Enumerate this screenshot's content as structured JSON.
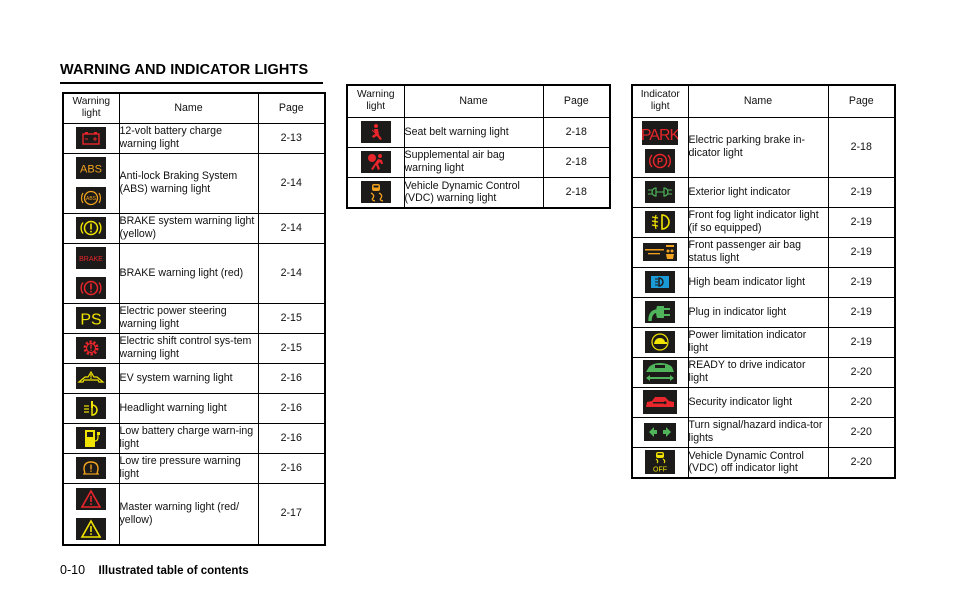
{
  "page_title": "WARNING AND INDICATOR LIGHTS",
  "tables": [
    {
      "headers": [
        "Warning light",
        "Name",
        "Page"
      ],
      "rows": [
        {
          "icons": [
            "battery-icon"
          ],
          "name": "12-volt battery charge warning light",
          "page": "2-13"
        },
        {
          "icons": [
            "abs-text-icon",
            "abs-circle-icon"
          ],
          "name": "Anti-lock Braking System (ABS) warning light",
          "page": "2-14"
        },
        {
          "icons": [
            "brake-yellow-icon"
          ],
          "name": "BRAKE system warning light (yellow)",
          "page": "2-14"
        },
        {
          "icons": [
            "brake-text-red-icon",
            "brake-circle-red-icon"
          ],
          "name": "BRAKE warning light (red)",
          "page": "2-14"
        },
        {
          "icons": [
            "ps-icon"
          ],
          "name": "Electric power steering warning light",
          "page": "2-15"
        },
        {
          "icons": [
            "shift-gear-icon"
          ],
          "name": "Electric shift control sys-tem warning light",
          "page": "2-15"
        },
        {
          "icons": [
            "ev-system-icon"
          ],
          "name": "EV system warning light",
          "page": "2-16"
        },
        {
          "icons": [
            "headlight-icon"
          ],
          "name": "Headlight warning light",
          "page": "2-16"
        },
        {
          "icons": [
            "low-battery-charge-icon"
          ],
          "name": "Low battery charge warn-ing light",
          "page": "2-16"
        },
        {
          "icons": [
            "tire-pressure-icon"
          ],
          "name": "Low tire pressure warning light",
          "page": "2-16"
        },
        {
          "icons": [
            "master-warning-red-icon",
            "master-warning-yellow-icon"
          ],
          "name": "Master warning light (red/ yellow)",
          "page": "2-17"
        }
      ]
    },
    {
      "headers": [
        "Warning light",
        "Name",
        "Page"
      ],
      "rows": [
        {
          "icons": [
            "seat-belt-icon"
          ],
          "name": "Seat belt warning light",
          "page": "2-18"
        },
        {
          "icons": [
            "airbag-icon"
          ],
          "name": "Supplemental air bag warning light",
          "page": "2-18"
        },
        {
          "icons": [
            "vdc-icon"
          ],
          "name": "Vehicle Dynamic Control (VDC) warning light",
          "page": "2-18"
        }
      ]
    },
    {
      "headers": [
        "Indicator light",
        "Name",
        "Page"
      ],
      "rows": [
        {
          "icons": [
            "park-text-icon",
            "park-circle-icon"
          ],
          "name": "Electric parking brake in-dicator light",
          "page": "2-18"
        },
        {
          "icons": [
            "exterior-light-icon"
          ],
          "name": "Exterior light indicator",
          "page": "2-19"
        },
        {
          "icons": [
            "front-fog-icon"
          ],
          "name": "Front fog light indicator light (if so equipped)",
          "page": "2-19"
        },
        {
          "icons": [
            "passenger-airbag-status-icon"
          ],
          "name": "Front passenger air bag status light",
          "page": "2-19"
        },
        {
          "icons": [
            "high-beam-icon"
          ],
          "name": "High beam indicator light",
          "page": "2-19"
        },
        {
          "icons": [
            "plug-in-icon"
          ],
          "name": "Plug in indicator light",
          "page": "2-19"
        },
        {
          "icons": [
            "power-limitation-icon"
          ],
          "name": "Power limitation indicator light",
          "page": "2-19"
        },
        {
          "icons": [
            "ready-to-drive-icon"
          ],
          "name": "READY to drive indicator light",
          "page": "2-20"
        },
        {
          "icons": [
            "security-icon"
          ],
          "name": "Security indicator light",
          "page": "2-20"
        },
        {
          "icons": [
            "turn-signal-icon"
          ],
          "name": "Turn signal/hazard indica-tor lights",
          "page": "2-20"
        },
        {
          "icons": [
            "vdc-off-icon"
          ],
          "name": "Vehicle Dynamic Control (VDC) off indicator light",
          "page": "2-20"
        }
      ]
    }
  ],
  "icon_text": {
    "abs": "ABS",
    "abs_small": "ABS",
    "brake": "BRAKE",
    "ps": "PS",
    "park": "PARK",
    "p": "P",
    "off": "OFF"
  },
  "colors": {
    "icon_bg": "#1d1a1a",
    "red": "#e8262b",
    "yellow": "#f1e400",
    "amber": "#f0a21e",
    "green": "#4fb45a",
    "blue": "#1a9bd7"
  },
  "footer": {
    "page_number": "0-10",
    "section": "Illustrated table of contents"
  }
}
